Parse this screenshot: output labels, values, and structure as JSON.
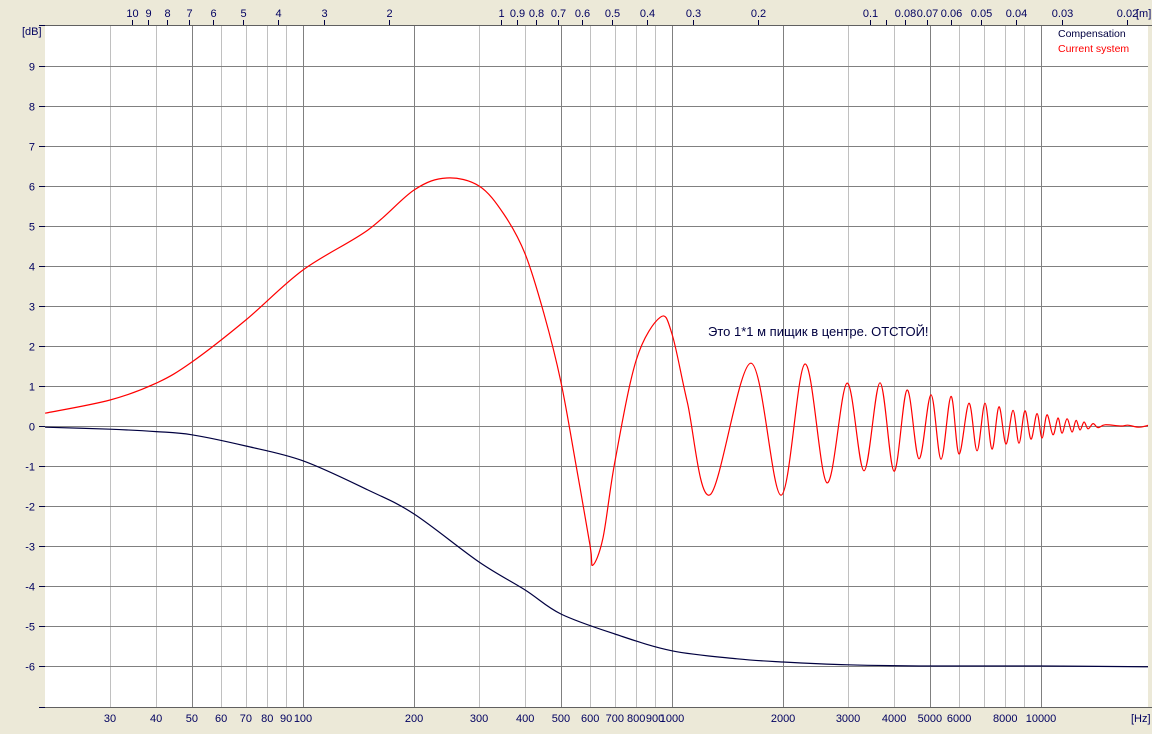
{
  "chart_data": {
    "type": "line",
    "title": "",
    "xlabel": "[Hz]",
    "ylabel": "[dB]",
    "top_axis_label": "[m]",
    "xscale": "log",
    "xlim": [
      20,
      20000
    ],
    "ylim": [
      -7,
      10
    ],
    "grid": true,
    "legend_position": "top-right",
    "speed_of_sound_m_s": 343,
    "yticks": [
      9,
      8,
      7,
      6,
      5,
      4,
      3,
      2,
      1,
      0,
      -1,
      -2,
      -3,
      -4,
      -5,
      -6
    ],
    "xticks": [
      30,
      40,
      50,
      60,
      70,
      80,
      90,
      100,
      200,
      300,
      400,
      500,
      600,
      700,
      800,
      900,
      1000,
      2000,
      3000,
      4000,
      5000,
      6000,
      8000,
      10000
    ],
    "xtick_labels": [
      "30",
      "40",
      "50",
      "60",
      "70",
      "80",
      "90",
      "100",
      "200",
      "300",
      "400",
      "500",
      "600",
      "700",
      "800",
      "900",
      "1000",
      "2000",
      "3000",
      "4000",
      "5000",
      "6000",
      "8000",
      "10000"
    ],
    "top_ticks_m": [
      10,
      9,
      8,
      7,
      6,
      5,
      4,
      3,
      2,
      1,
      0.9,
      0.8,
      0.7,
      0.6,
      0.5,
      0.4,
      0.3,
      0.2,
      0.1,
      0.09,
      0.08,
      0.07,
      0.06,
      0.05,
      0.04,
      0.03,
      0.02
    ],
    "top_tick_labels": [
      "10",
      "9",
      "8",
      "7",
      "6",
      "5",
      "4",
      "3",
      "2",
      "1",
      "0.9",
      "0.8",
      "0.7",
      "0.6",
      "0.5",
      "0.4",
      "0.3",
      "0.2",
      "0.1",
      "",
      "0.08",
      "0.07",
      "0.06",
      "0.05",
      "0.04",
      "0.03",
      "0.02"
    ],
    "annotation": "Это 1*1 м пищик в центре. ОТСТОЙ!",
    "series": [
      {
        "name": "Compensation",
        "color": "#000040",
        "points": [
          [
            20,
            -0.03
          ],
          [
            30,
            -0.08
          ],
          [
            40,
            -0.14
          ],
          [
            50,
            -0.22
          ],
          [
            70,
            -0.5
          ],
          [
            100,
            -0.87
          ],
          [
            150,
            -1.6
          ],
          [
            200,
            -2.2
          ],
          [
            300,
            -3.4
          ],
          [
            400,
            -4.1
          ],
          [
            500,
            -4.7
          ],
          [
            700,
            -5.2
          ],
          [
            1000,
            -5.62
          ],
          [
            1500,
            -5.82
          ],
          [
            2000,
            -5.9
          ],
          [
            3000,
            -5.97
          ],
          [
            5000,
            -6.0
          ],
          [
            10000,
            -6.0
          ],
          [
            20000,
            -6.02
          ]
        ]
      },
      {
        "name": "Current system",
        "color": "#FF0000",
        "points": [
          [
            20,
            0.32
          ],
          [
            30,
            0.65
          ],
          [
            40,
            1.07
          ],
          [
            50,
            1.6
          ],
          [
            70,
            2.65
          ],
          [
            100,
            3.9
          ],
          [
            150,
            4.9
          ],
          [
            200,
            5.9
          ],
          [
            245,
            6.2
          ],
          [
            300,
            6.0
          ],
          [
            350,
            5.3
          ],
          [
            400,
            4.3
          ],
          [
            450,
            2.8
          ],
          [
            500,
            1.1
          ],
          [
            550,
            -1.0
          ],
          [
            600,
            -3.0
          ],
          [
            610,
            -3.48
          ],
          [
            650,
            -2.8
          ],
          [
            700,
            -0.9
          ],
          [
            800,
            1.65
          ],
          [
            930,
            2.72
          ],
          [
            1000,
            2.3
          ],
          [
            1100,
            0.6
          ],
          [
            1268,
            -1.72
          ],
          [
            1636,
            1.57
          ],
          [
            1974,
            -1.73
          ],
          [
            2293,
            1.55
          ],
          [
            2630,
            -1.42
          ],
          [
            2981,
            1.07
          ],
          [
            3314,
            -1.12
          ],
          [
            3662,
            1.08
          ],
          [
            3997,
            -1.13
          ],
          [
            4335,
            0.9
          ],
          [
            4671,
            -0.82
          ],
          [
            5034,
            0.78
          ],
          [
            5358,
            -0.83
          ],
          [
            5703,
            0.74
          ],
          [
            5995,
            -0.7
          ],
          [
            6381,
            0.57
          ],
          [
            6709,
            -0.62
          ],
          [
            7050,
            0.57
          ],
          [
            7367,
            -0.58
          ],
          [
            7693,
            0.48
          ],
          [
            8036,
            -0.45
          ],
          [
            8398,
            0.39
          ],
          [
            8716,
            -0.43
          ],
          [
            9048,
            0.38
          ],
          [
            9395,
            -0.33
          ],
          [
            9754,
            0.31
          ],
          [
            10063,
            -0.3
          ],
          [
            10382,
            0.28
          ],
          [
            10778,
            -0.22
          ],
          [
            11119,
            0.2
          ],
          [
            11401,
            -0.18
          ],
          [
            11762,
            0.18
          ],
          [
            12134,
            -0.15
          ],
          [
            12443,
            0.14
          ],
          [
            12758,
            -0.1
          ],
          [
            13080,
            0.1
          ],
          [
            13411,
            -0.07
          ],
          [
            13837,
            0.06
          ],
          [
            14275,
            -0.04
          ],
          [
            14913,
            0.03
          ],
          [
            16470,
            0.0
          ],
          [
            17200,
            0.02
          ],
          [
            18430,
            -0.03
          ],
          [
            19600,
            0.02
          ]
        ]
      }
    ]
  }
}
